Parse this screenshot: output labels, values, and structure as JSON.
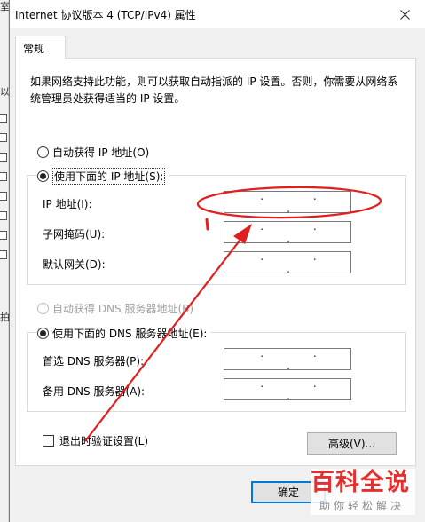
{
  "window": {
    "title": "Internet 协议版本 4 (TCP/IPv4) 属性"
  },
  "tab": {
    "label": "常规"
  },
  "description": "如果网络支持此功能，则可以获取自动指派的 IP 设置。否则，你需要从网络系统管理员处获得适当的 IP 设置。",
  "ip_section": {
    "auto_label": "自动获得 IP 地址(O)",
    "manual_label": "使用下面的 IP 地址(S):",
    "fields": [
      {
        "label": "IP 地址(I):",
        "value": ". . ."
      },
      {
        "label": "子网掩码(U):",
        "value": ". . ."
      },
      {
        "label": "默认网关(D):",
        "value": ". . ."
      }
    ]
  },
  "dns_section": {
    "auto_label": "自动获得 DNS 服务器地址(B)",
    "manual_label": "使用下面的 DNS 服务器地址(E):",
    "fields": [
      {
        "label": "首选 DNS 服务器(P):",
        "value": ". . ."
      },
      {
        "label": "备用 DNS 服务器(A):",
        "value": ". . ."
      }
    ]
  },
  "validate_label": "退出时验证设置(L)",
  "advanced_button": "高级(V)...",
  "ok_button": "确定",
  "watermark": {
    "main": "百科全说",
    "sub": "助你轻松解决"
  },
  "annotation_color": "#e02020",
  "background_window": {
    "glyphs": [
      "室",
      "以",
      "拍"
    ]
  }
}
